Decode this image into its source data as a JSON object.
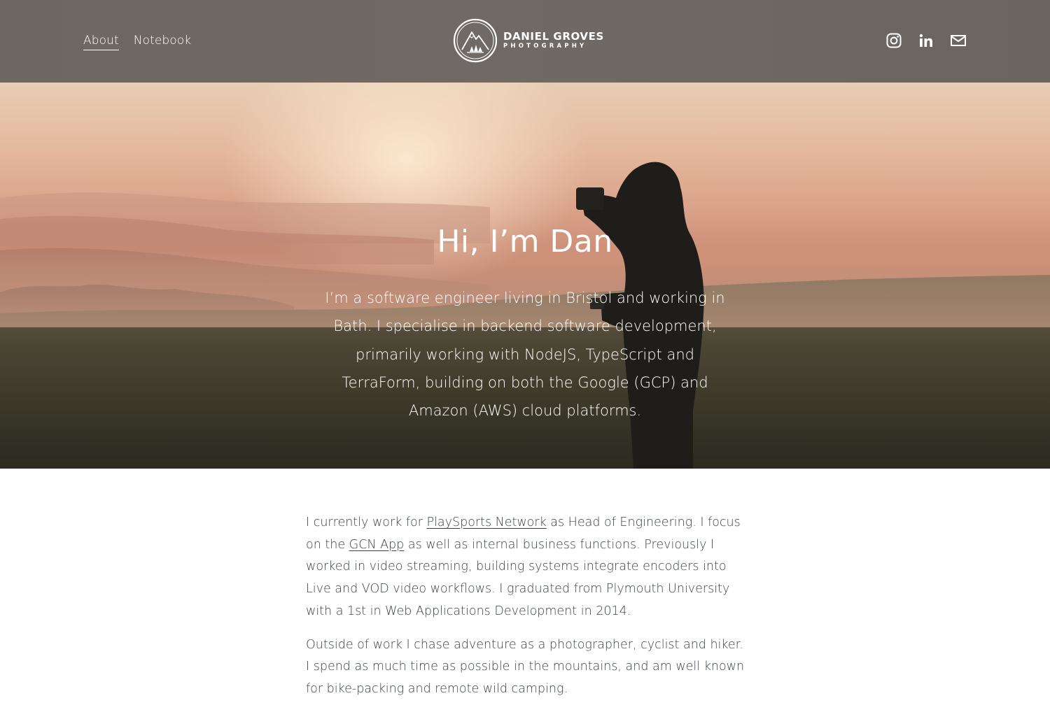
{
  "header": {
    "nav": [
      {
        "label": "About",
        "active": true
      },
      {
        "label": "Notebook",
        "active": false
      }
    ],
    "logo": {
      "name": "DANIEL GROVES",
      "subtitle": "PHOTOGRAPHY"
    },
    "social": [
      "instagram-icon",
      "linkedin-icon",
      "email-icon"
    ]
  },
  "hero": {
    "title": "Hi, I’m Dan",
    "text": "I’m a software engineer living in Bristol and working in Bath. I specialise in backend software development, primarily working with NodeJS, TypeScript and TerraForm, building on both the Google (GCP) and Amazon (AWS) cloud platforms."
  },
  "content": {
    "p1": {
      "pre": "I currently work for ",
      "link1": "PlaySports Network",
      "mid": " as Head of Engineering. I focus on the ",
      "link2": "GCN App",
      "post": " as well as internal business functions. Previously I worked in video streaming, building systems integrate encoders into Live and VOD video workflows. I graduated from Plymouth University with a 1st in Web Applications Development in 2014."
    },
    "p2": "Outside of work I chase adventure as a photographer, cyclist and hiker. I spend as much time as possible in the mountains, and am well known for bike-packing and remote wild camping."
  },
  "colors": {
    "header_bg": "#6e6864",
    "text": "#3a3f4a",
    "white": "#ffffff"
  }
}
